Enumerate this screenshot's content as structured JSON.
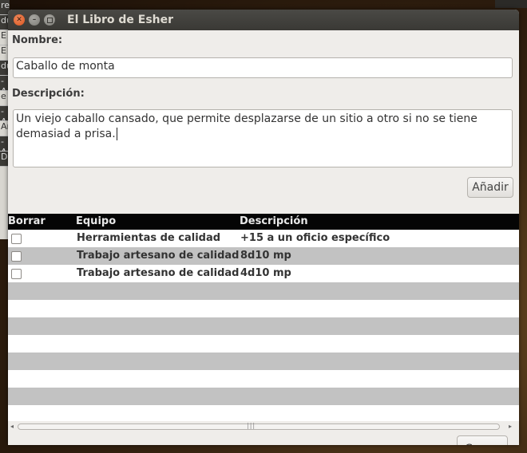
{
  "window": {
    "title": "El Libro de Esher"
  },
  "form": {
    "name_label": "Nombre:",
    "name_value": "Caballo de monta",
    "desc_label": "Descripción:",
    "desc_value": "Un viejo caballo cansado, que permite desplazarse de un sitio a otro si no se tiene demasiad a prisa.",
    "add_button": "Añadir"
  },
  "table": {
    "headers": [
      "Borrar",
      "Equipo",
      "Descripción"
    ],
    "rows": [
      {
        "equipo": "Herramientas de calidad",
        "descripcion": "+15 a un oficio específico",
        "checked": false
      },
      {
        "equipo": "Trabajo artesano de calidad",
        "descripcion": "8d10 mp",
        "checked": false
      },
      {
        "equipo": "Trabajo artesano de calidad",
        "descripcion": "4d10 mp",
        "checked": false
      }
    ]
  },
  "footer": {
    "close_button": "Cerrar"
  },
  "background": {
    "rows": [
      "re",
      "du",
      "E",
      "E",
      "du",
      "-A",
      "e",
      "-A",
      "Ar",
      "-A",
      "Dl"
    ]
  }
}
